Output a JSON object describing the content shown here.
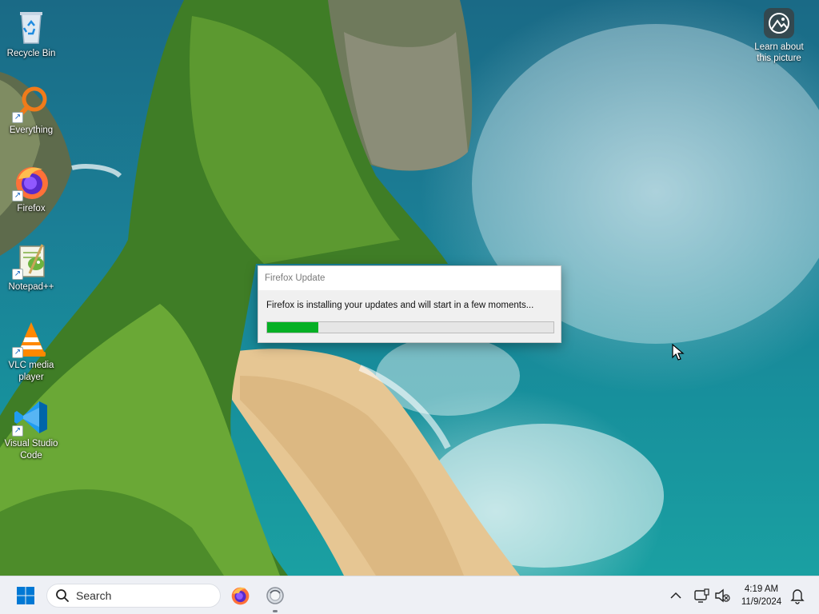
{
  "desktop": {
    "icons": [
      {
        "label": "Recycle Bin",
        "icon": "recycle-bin-icon"
      },
      {
        "label": "Everything",
        "icon": "everything-icon"
      },
      {
        "label": "Firefox",
        "icon": "firefox-icon"
      },
      {
        "label": "Notepad++",
        "icon": "notepadpp-icon"
      },
      {
        "label": "VLC media player",
        "icon": "vlc-icon"
      },
      {
        "label": "Visual Studio Code",
        "icon": "vscode-icon"
      }
    ],
    "learn_picture": {
      "label": "Learn about this picture",
      "icon": "camera-icon"
    }
  },
  "dialog": {
    "title": "Firefox Update",
    "message": "Firefox is installing your updates and will start in a few moments...",
    "progress_percent": 18,
    "progress_color": "#06b025"
  },
  "taskbar": {
    "search_placeholder": "Search",
    "pinned": [
      {
        "name": "firefox",
        "icon": "firefox-icon"
      },
      {
        "name": "firefox-updater",
        "icon": "updater-icon",
        "running": true
      }
    ],
    "clock": {
      "time": "4:19 AM",
      "date": "11/9/2024"
    },
    "tray_icons": [
      "chevron-up-icon",
      "network-icon",
      "volume-muted-icon",
      "bell-icon"
    ]
  },
  "colors": {
    "taskbar_bg": "#eef0f5",
    "windows_blue": "#0078d4"
  }
}
